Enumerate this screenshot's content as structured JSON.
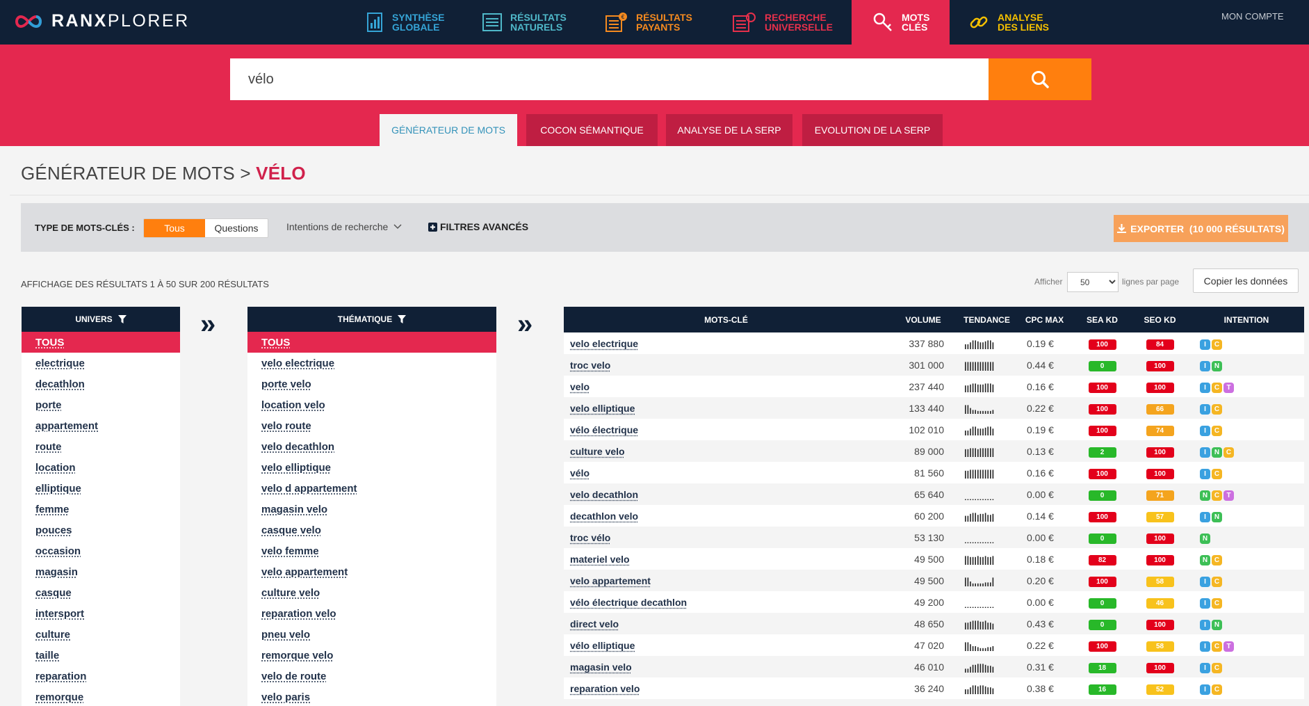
{
  "brand": {
    "name_bold": "RANX",
    "name_rest": "PLORER"
  },
  "nav": [
    {
      "label": "SYNTHÈSE\nGLOBALE",
      "icon": "chart-icon",
      "color": "#35a4d6"
    },
    {
      "label": "RÉSULTATS\nNATURELS",
      "icon": "list-icon",
      "color": "#4fb8c9"
    },
    {
      "label": "RÉSULTATS\nPAYANTS",
      "icon": "paid-list-icon",
      "color": "#f58a1f"
    },
    {
      "label": "RECHERCHE\nUNIVERSELLE",
      "icon": "universal-search-icon",
      "color": "#e6304b"
    },
    {
      "label": "MOTS\nCLÉS",
      "icon": "keys-icon",
      "color": "#ffffff",
      "active": true
    },
    {
      "label": "ANALYSE\nDES LIENS",
      "icon": "link-icon",
      "color": "#f5c000"
    }
  ],
  "account": "MON COMPTE",
  "search": {
    "value": "vélo"
  },
  "subtabs": [
    "GÉNÉRATEUR DE MOTS",
    "COCON SÉMANTIQUE",
    "ANALYSE DE LA SERP",
    "EVOLUTION DE LA SERP"
  ],
  "title": {
    "prefix": "GÉNÉRATEUR DE MOTS >",
    "highlight": "VÉLO"
  },
  "filters": {
    "type_label": "TYPE DE MOTS-CLÉS :",
    "seg_on": "Tous",
    "seg_off": "Questions",
    "intent_dropdown": "Intentions de recherche",
    "advanced": "FILTRES AVANCÉS",
    "export": "EXPORTER  (10 000 RÉSULTATS)"
  },
  "results_info": "AFFICHAGE DES RÉSULTATS 1 À 50 SUR 200 RÉSULTATS",
  "page_size": {
    "prefix": "Afficher",
    "value": "50",
    "suffix": "lignes par page"
  },
  "copy_button": "Copier les données",
  "univers": {
    "header": "UNIVERS",
    "items": [
      "TOUS",
      "electrique",
      "decathlon",
      "porte",
      "appartement",
      "route",
      "location",
      "elliptique",
      "femme",
      "pouces",
      "occasion",
      "magasin",
      "casque",
      "intersport",
      "culture",
      "taille",
      "reparation",
      "remorque"
    ]
  },
  "thematique": {
    "header": "THÉMATIQUE",
    "items": [
      "TOUS",
      "velo electrique",
      "porte velo",
      "location velo",
      "velo route",
      "velo decathlon",
      "velo elliptique",
      "velo d appartement",
      "magasin velo",
      "casque velo",
      "velo femme",
      "velo appartement",
      "culture velo",
      "reparation velo",
      "pneu velo",
      "remorque velo",
      "velo de route",
      "velo paris"
    ]
  },
  "keywords": {
    "headers": [
      "MOTS-CLÉ",
      "VOLUME",
      "TENDANCE",
      "CPC MAX",
      "SEA KD",
      "SEO KD",
      "INTENTION"
    ],
    "rows": [
      {
        "kw": "velo electrique",
        "vol": "337 880",
        "trend": [
          5,
          7,
          9,
          8,
          7,
          8,
          9,
          7
        ],
        "cpc": "0.19 €",
        "sea": "100",
        "seo": "84",
        "intent": [
          "I",
          "C"
        ]
      },
      {
        "kw": "troc velo",
        "vol": "301 000",
        "trend": [
          9,
          9,
          9,
          9,
          9,
          9,
          9,
          9
        ],
        "cpc": "0.44 €",
        "sea": "0",
        "seo": "100",
        "intent": [
          "I",
          "N"
        ]
      },
      {
        "kw": "velo",
        "vol": "237 440",
        "trend": [
          7,
          8,
          9,
          8,
          8,
          9,
          9,
          8
        ],
        "cpc": "0.16 €",
        "sea": "100",
        "seo": "100",
        "intent": [
          "I",
          "C",
          "T"
        ]
      },
      {
        "kw": "velo elliptique",
        "vol": "133 440",
        "trend": [
          9,
          6,
          4,
          3,
          3,
          3,
          3,
          4
        ],
        "cpc": "0.22 €",
        "sea": "100",
        "seo": "66",
        "intent": [
          "I",
          "C"
        ]
      },
      {
        "kw": "vélo électrique",
        "vol": "102 010",
        "trend": [
          5,
          7,
          9,
          7,
          7,
          8,
          9,
          7
        ],
        "cpc": "0.19 €",
        "sea": "100",
        "seo": "74",
        "intent": [
          "I",
          "C"
        ]
      },
      {
        "kw": "culture velo",
        "vol": "89 000",
        "trend": [
          8,
          9,
          9,
          8,
          9,
          9,
          9,
          9
        ],
        "cpc": "0.13 €",
        "sea": "2",
        "seo": "100",
        "intent": [
          "I",
          "N",
          "C"
        ]
      },
      {
        "kw": "vélo",
        "vol": "81 560",
        "trend": [
          8,
          9,
          9,
          9,
          9,
          9,
          9,
          9
        ],
        "cpc": "0.16 €",
        "sea": "100",
        "seo": "100",
        "intent": [
          "I",
          "C"
        ]
      },
      {
        "kw": "velo decathlon",
        "vol": "65 640",
        "trend": [
          1,
          1,
          1,
          1,
          1,
          1,
          1,
          1
        ],
        "cpc": "0.00 €",
        "sea": "0",
        "seo": "71",
        "intent": [
          "N",
          "C",
          "T"
        ]
      },
      {
        "kw": "decathlon velo",
        "vol": "60 200",
        "trend": [
          6,
          8,
          9,
          7,
          8,
          9,
          7,
          8
        ],
        "cpc": "0.14 €",
        "sea": "100",
        "seo": "57",
        "intent": [
          "I",
          "N"
        ]
      },
      {
        "kw": "troc vélo",
        "vol": "53 130",
        "trend": [
          1,
          1,
          1,
          1,
          1,
          1,
          1,
          1
        ],
        "cpc": "0.00 €",
        "sea": "0",
        "seo": "100",
        "intent": [
          "N"
        ]
      },
      {
        "kw": "materiel velo",
        "vol": "49 500",
        "trend": [
          9,
          8,
          8,
          9,
          8,
          9,
          8,
          9
        ],
        "cpc": "0.18 €",
        "sea": "82",
        "seo": "100",
        "intent": [
          "N",
          "C"
        ]
      },
      {
        "kw": "velo appartement",
        "vol": "49 500",
        "trend": [
          9,
          5,
          3,
          3,
          3,
          4,
          4,
          9
        ],
        "cpc": "0.20 €",
        "sea": "100",
        "seo": "58",
        "intent": [
          "I",
          "C"
        ]
      },
      {
        "kw": "vélo électrique decathlon",
        "vol": "49 200",
        "trend": [
          1,
          1,
          1,
          1,
          1,
          1,
          1,
          1
        ],
        "cpc": "0.00 €",
        "sea": "0",
        "seo": "46",
        "intent": [
          "I",
          "C"
        ]
      },
      {
        "kw": "direct velo",
        "vol": "48 650",
        "trend": [
          7,
          8,
          9,
          9,
          8,
          9,
          7,
          6
        ],
        "cpc": "0.43 €",
        "sea": "0",
        "seo": "100",
        "intent": [
          "I",
          "N"
        ]
      },
      {
        "kw": "vélo elliptique",
        "vol": "47 020",
        "trend": [
          9,
          7,
          5,
          4,
          3,
          3,
          4,
          5
        ],
        "cpc": "0.22 €",
        "sea": "100",
        "seo": "58",
        "intent": [
          "I",
          "C",
          "T"
        ]
      },
      {
        "kw": "magasin velo",
        "vol": "46 010",
        "trend": [
          4,
          6,
          8,
          9,
          9,
          8,
          7,
          6
        ],
        "cpc": "0.31 €",
        "sea": "18",
        "seo": "100",
        "intent": [
          "I",
          "C"
        ]
      },
      {
        "kw": "reparation velo",
        "vol": "36 240",
        "trend": [
          5,
          7,
          9,
          8,
          9,
          8,
          7,
          6
        ],
        "cpc": "0.38 €",
        "sea": "16",
        "seo": "52",
        "intent": [
          "I",
          "C"
        ]
      },
      {
        "kw": "",
        "vol": "",
        "trend": [],
        "cpc": "",
        "sea": "",
        "seo": "",
        "intent": []
      }
    ]
  },
  "colors": {
    "navy": "#102036",
    "red": "#e4284f",
    "orange": "#ff7f0e",
    "kd_red": "#e3001b",
    "kd_green": "#28b829",
    "kd_orange": "#f4a41e",
    "kd_yellow": "#f8c21c",
    "intent_I": "#3aa1e0",
    "intent_N": "#3dbf56",
    "intent_C": "#f5b623",
    "intent_T": "#cc6fe0"
  }
}
